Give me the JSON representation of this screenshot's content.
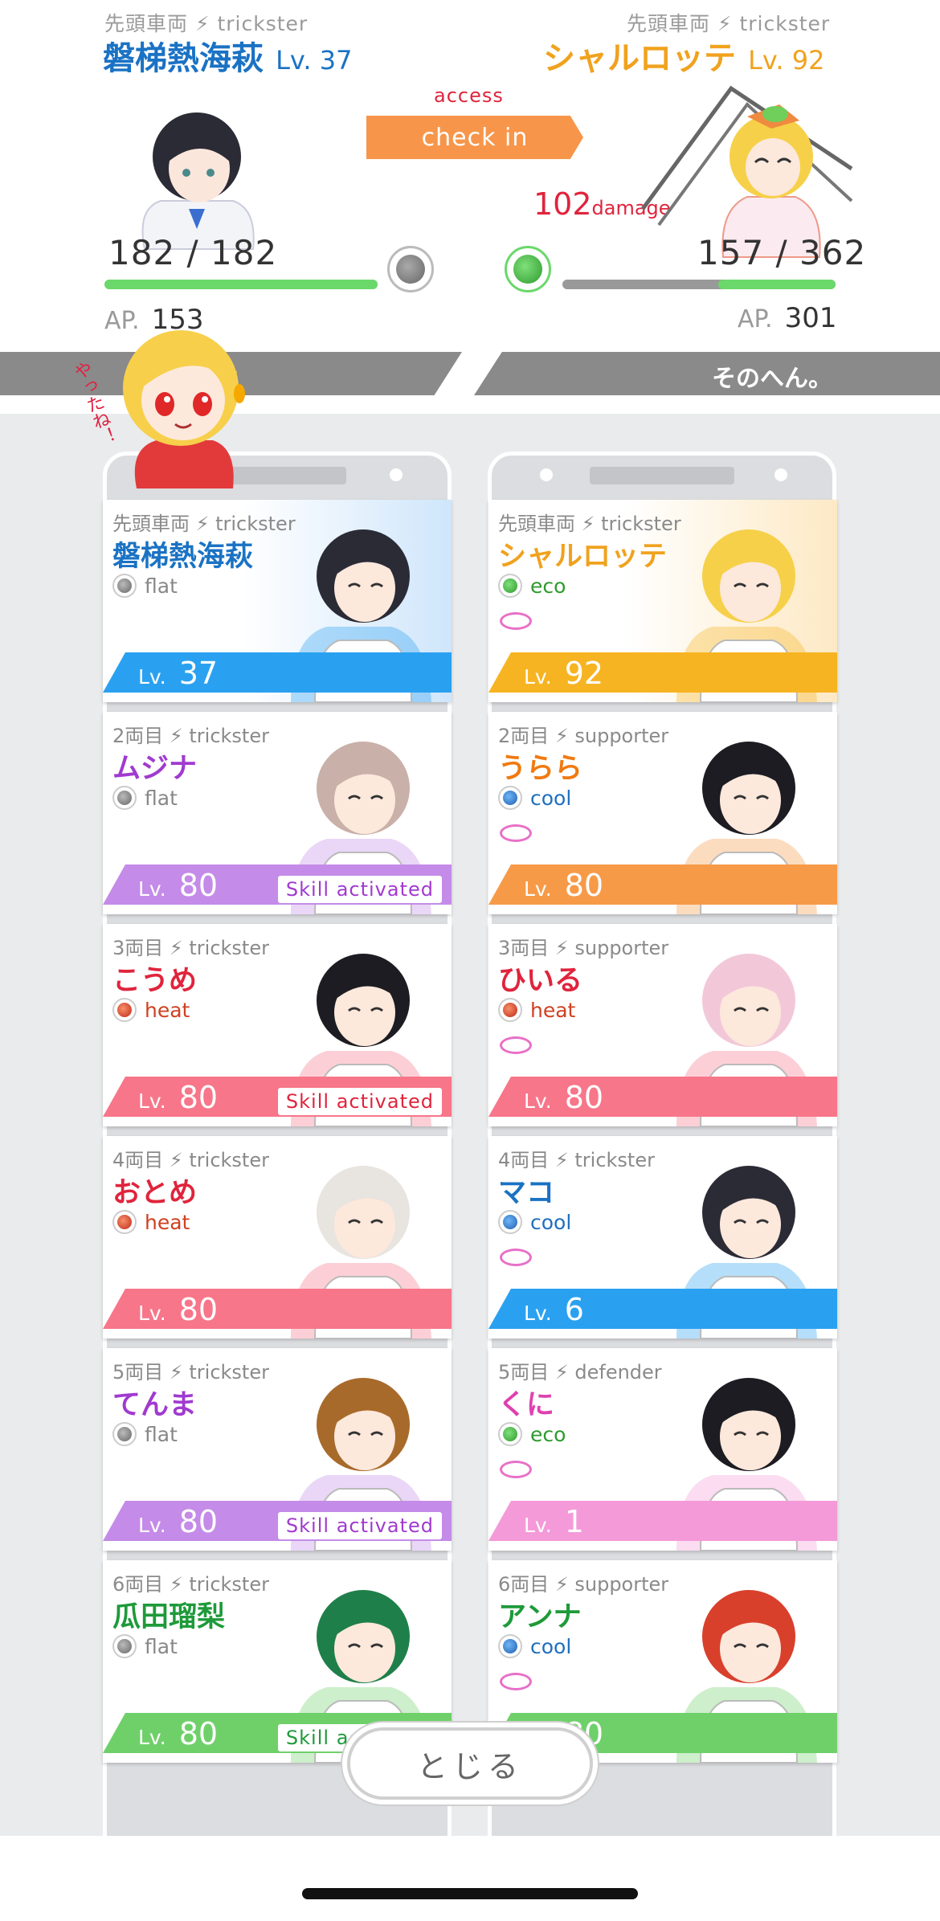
{
  "battle": {
    "left": {
      "position": "先頭車両 ⚡ trickster",
      "name": "磐梯熱海萩",
      "level": "Lv. 37",
      "hp": "182 / 182",
      "hp_fraction": 1.0,
      "ap_label": "AP.",
      "ap_value": "153",
      "color": "#1a72c4"
    },
    "right": {
      "position": "先頭車両 ⚡ trickster",
      "name": "シャルロッテ",
      "level": "Lv. 92",
      "hp": "157 / 362",
      "hp_fraction": 0.43,
      "ap_label": "AP.",
      "ap_value": "301",
      "color": "#f0a21e"
    },
    "access": "access",
    "check_in": "check in",
    "damage_number": "102",
    "damage_label": "damage"
  },
  "banner": {
    "right_text": "そのへん。",
    "sticker_text": "やったね！"
  },
  "left_team": [
    {
      "pos": "先頭車両 ⚡ trickster",
      "name": "磐梯熱海萩",
      "attr": "flat",
      "lv_label": "Lv.",
      "lv": "37",
      "skill": "",
      "name_color": "#1a72c4",
      "bar_color": "#2aa1f0",
      "attr_color": "#888888"
    },
    {
      "pos": "2両目 ⚡ trickster",
      "name": "ムジナ",
      "attr": "flat",
      "lv_label": "Lv.",
      "lv": "80",
      "skill": "Skill activated",
      "name_color": "#a03ad0",
      "bar_color": "#c48be8",
      "attr_color": "#888888"
    },
    {
      "pos": "3両目 ⚡ trickster",
      "name": "こうめ",
      "attr": "heat",
      "lv_label": "Lv.",
      "lv": "80",
      "skill": "Skill activated",
      "name_color": "#e0243c",
      "bar_color": "#f7768a",
      "attr_color": "#d04020"
    },
    {
      "pos": "4両目 ⚡ trickster",
      "name": "おとめ",
      "attr": "heat",
      "lv_label": "Lv.",
      "lv": "80",
      "skill": "",
      "name_color": "#e0243c",
      "bar_color": "#f7768a",
      "attr_color": "#d04020"
    },
    {
      "pos": "5両目 ⚡ trickster",
      "name": "てんま",
      "attr": "flat",
      "lv_label": "Lv.",
      "lv": "80",
      "skill": "Skill activated",
      "name_color": "#a03ad0",
      "bar_color": "#c48be8",
      "attr_color": "#888888"
    },
    {
      "pos": "6両目 ⚡ trickster",
      "name": "瓜田瑠梨",
      "attr": "flat",
      "lv_label": "Lv.",
      "lv": "80",
      "skill": "Skill activated",
      "name_color": "#1e9a3a",
      "bar_color": "#6fd06a",
      "attr_color": "#888888"
    }
  ],
  "right_team": [
    {
      "pos": "先頭車両 ⚡ trickster",
      "name": "シャルロッテ",
      "attr": "eco",
      "lv_label": "Lv.",
      "lv": "92",
      "name_color": "#f0a21e",
      "bar_color": "#f7b422",
      "attr_color": "#2e9a2e"
    },
    {
      "pos": "2両目 ⚡ supporter",
      "name": "うらら",
      "attr": "cool",
      "lv_label": "Lv.",
      "lv": "80",
      "name_color": "#f07a10",
      "bar_color": "#f79a48",
      "attr_color": "#1f6fc0"
    },
    {
      "pos": "3両目 ⚡ supporter",
      "name": "ひいる",
      "attr": "heat",
      "lv_label": "Lv.",
      "lv": "80",
      "name_color": "#e0243c",
      "bar_color": "#f7768a",
      "attr_color": "#d04020"
    },
    {
      "pos": "4両目 ⚡ trickster",
      "name": "マコ",
      "attr": "cool",
      "lv_label": "Lv.",
      "lv": "6",
      "name_color": "#1a72c4",
      "bar_color": "#2aa1f0",
      "attr_color": "#1f6fc0"
    },
    {
      "pos": "5両目 ⚡ defender",
      "name": "くに",
      "attr": "eco",
      "lv_label": "Lv.",
      "lv": "1",
      "name_color": "#e040b0",
      "bar_color": "#f49ad8",
      "attr_color": "#2e9a2e"
    },
    {
      "pos": "6両目 ⚡ supporter",
      "name": "アンナ",
      "attr": "cool",
      "lv_label": "Lv.",
      "lv": "80",
      "name_color": "#1e9a3a",
      "bar_color": "#6fd06a",
      "attr_color": "#1f6fc0"
    }
  ],
  "close_label": "とじる"
}
